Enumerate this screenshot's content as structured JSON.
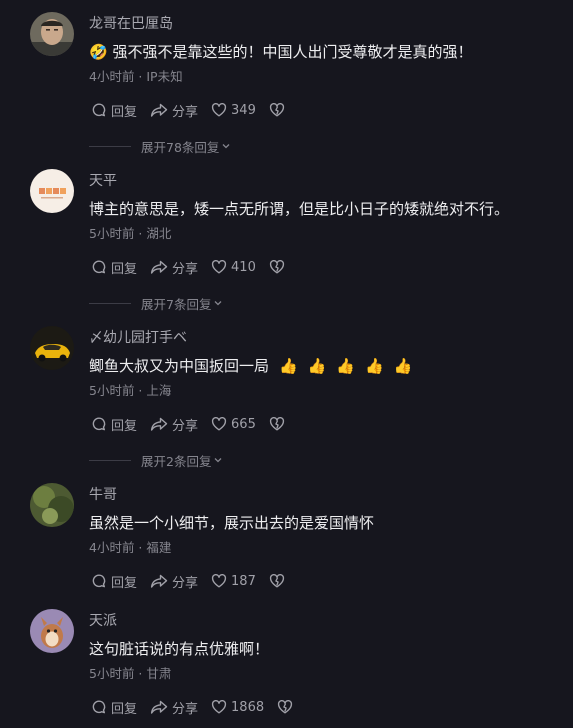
{
  "comments": [
    {
      "name": "龙哥在巴厘岛",
      "text": "强不强不是靠这些的！中国人出门受尊敬才是真的强！",
      "emoji": "🤣",
      "time": "4小时前",
      "location": "IP未知",
      "reply_label": "回复",
      "share_label": "分享",
      "likes": "349",
      "expand_label": "展开78条回复"
    },
    {
      "name": "天平",
      "text": "博主的意思是，矮一点无所谓，但是比小日子的矮就绝对不行。",
      "time": "5小时前",
      "location": "湖北",
      "reply_label": "回复",
      "share_label": "分享",
      "likes": "410",
      "expand_label": "展开7条回复"
    },
    {
      "name": "〆幼儿园打手ベ",
      "text": "鲫鱼大叔又为中国扳回一局",
      "emoji": "👍",
      "time": "5小时前",
      "location": "上海",
      "reply_label": "回复",
      "share_label": "分享",
      "likes": "665",
      "expand_label": "展开2条回复"
    },
    {
      "name": "牛哥",
      "text": "虽然是一个小细节，展示出去的是爱国情怀",
      "time": "4小时前",
      "location": "福建",
      "reply_label": "回复",
      "share_label": "分享",
      "likes": "187"
    },
    {
      "name": "天派",
      "text": "这句脏话说的有点优雅啊！",
      "time": "5小时前",
      "location": "甘肃",
      "reply_label": "回复",
      "share_label": "分享",
      "likes": "1868"
    }
  ],
  "colors": {
    "background": "#16161e",
    "name_text": "#a9a9b1",
    "comment_text": "#eeeef0",
    "meta_text": "#85858e"
  },
  "icons": [
    "reply-icon",
    "share-icon",
    "like-heart-icon",
    "dislike-heart-icon",
    "chevron-down-icon"
  ]
}
